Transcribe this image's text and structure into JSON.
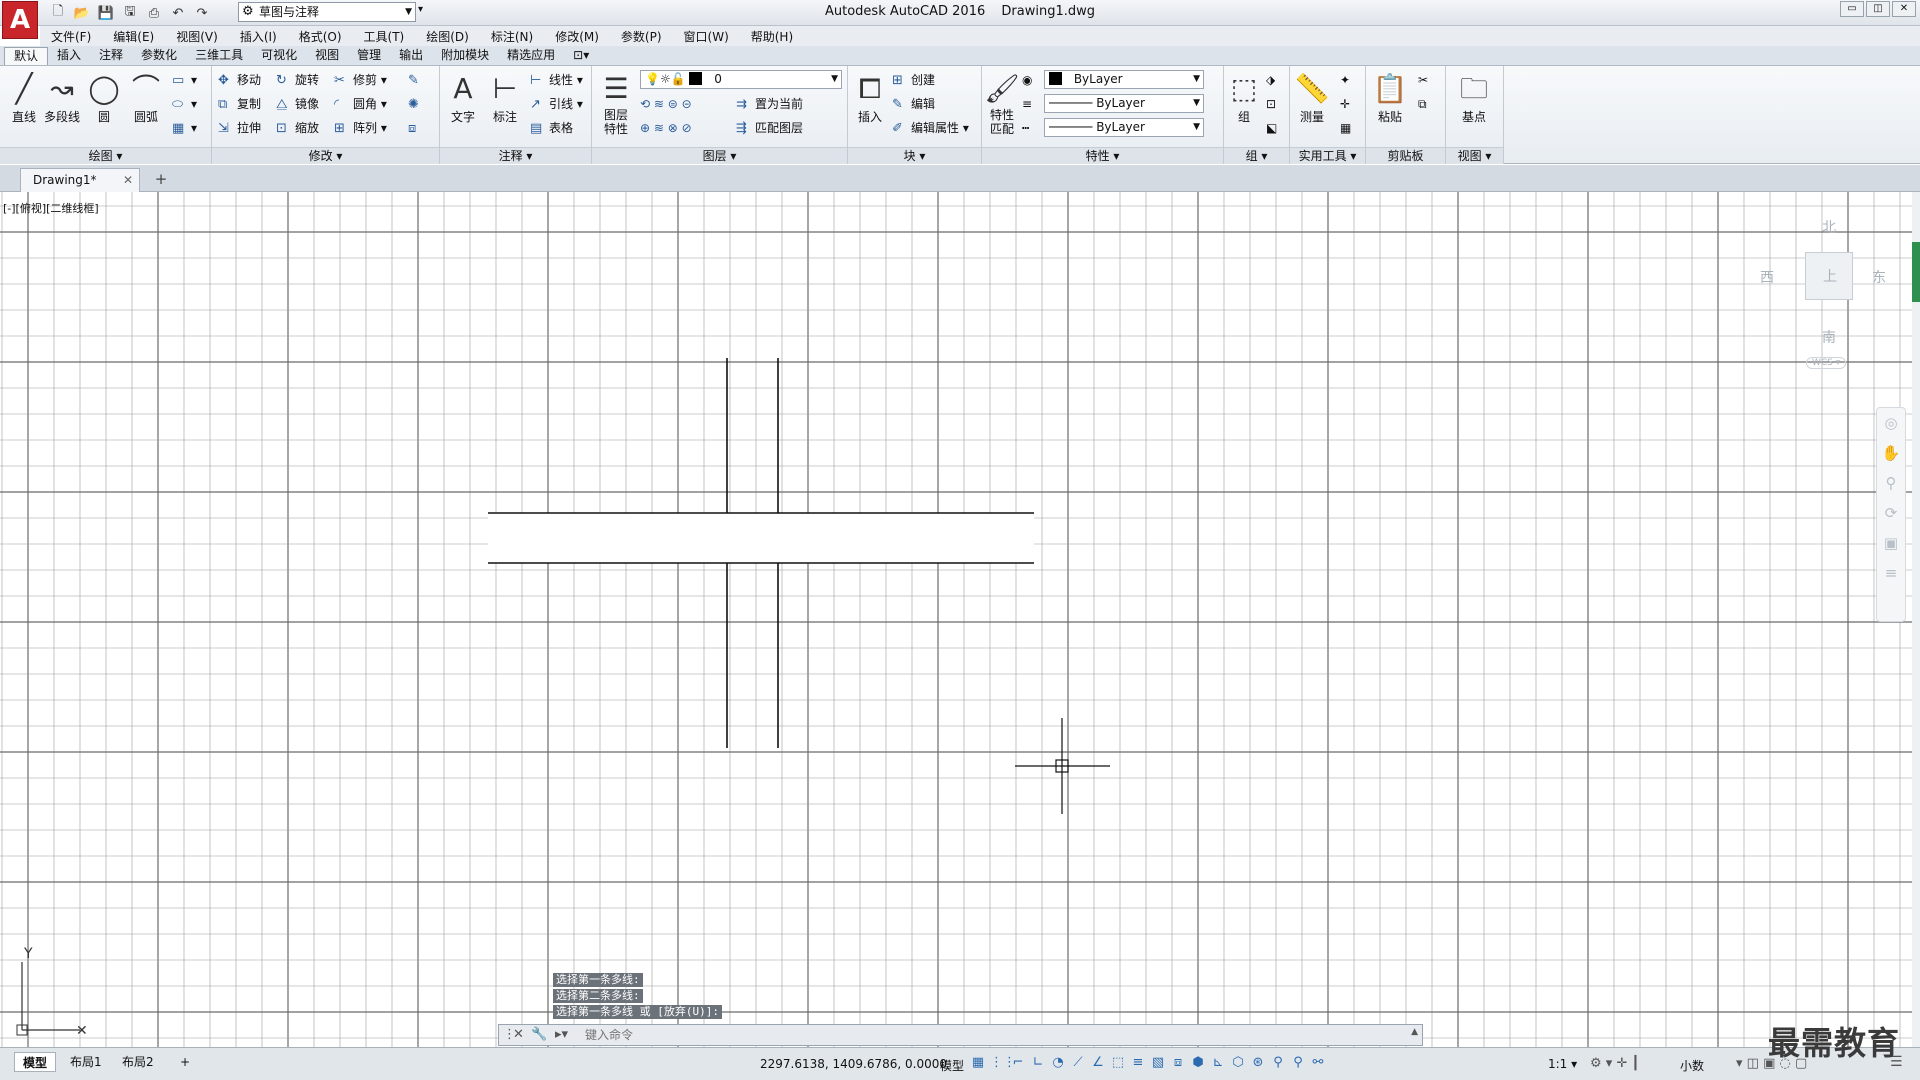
{
  "app": {
    "logo": "A",
    "title": "Autodesk AutoCAD 2016",
    "document": "Drawing1.dwg",
    "workspace": "草图与注释"
  },
  "window_controls": [
    "▭",
    "◫",
    "✕"
  ],
  "menu": [
    "文件(F)",
    "编辑(E)",
    "视图(V)",
    "插入(I)",
    "格式(O)",
    "工具(T)",
    "绘图(D)",
    "标注(N)",
    "修改(M)",
    "参数(P)",
    "窗口(W)",
    "帮助(H)"
  ],
  "ribbon_tabs": [
    "默认",
    "插入",
    "注释",
    "参数化",
    "三维工具",
    "可视化",
    "视图",
    "管理",
    "输出",
    "附加模块",
    "精选应用"
  ],
  "ribbon": {
    "draw": {
      "title": "绘图 ▾",
      "line": "直线",
      "polyline": "多段线",
      "circle": "圆",
      "arc": "圆弧"
    },
    "modify": {
      "title": "修改 ▾",
      "move": "移动",
      "rotate": "旋转",
      "trim": "修剪",
      "copy": "复制",
      "mirror": "镜像",
      "fillet": "圆角",
      "stretch": "拉伸",
      "scale": "缩放",
      "array": "阵列"
    },
    "annotation": {
      "title": "注释 ▾",
      "text": "文字",
      "dimension": "标注",
      "linear": "线性",
      "leader": "引线",
      "table": "表格"
    },
    "layers": {
      "title": "图层 ▾",
      "properties_l1": "图层",
      "properties_l2": "特性",
      "layer_value": "0",
      "set_current": "置为当前",
      "match_layer": "匹配图层"
    },
    "block": {
      "title": "块 ▾",
      "insert": "插入",
      "create": "创建",
      "edit": "编辑",
      "edit_attributes": "编辑属性"
    },
    "properties": {
      "title": "特性 ▾",
      "match_l1": "特性",
      "match_l2": "匹配",
      "color": "ByLayer",
      "linetype": "ByLayer",
      "lineweight": "ByLayer"
    },
    "groups": {
      "title": "组 ▾",
      "group": "组"
    },
    "utilities": {
      "title": "实用工具 ▾",
      "measure": "测量"
    },
    "clipboard": {
      "title": "剪贴板",
      "paste": "粘贴"
    },
    "view": {
      "title": "视图 ▾",
      "basepoint": "基点"
    }
  },
  "doc_tab": {
    "label": "Drawing1*",
    "close": "✕",
    "new": "+"
  },
  "viewport": {
    "label": "[-][俯视][二维线框]",
    "viewcube": {
      "north": "北",
      "south": "南",
      "west": "西",
      "east": "东",
      "face": "上",
      "wcs": "WCS ▾"
    }
  },
  "command": {
    "history": [
      "选择第一条多线:",
      "选择第二条多线:",
      "选择第一条多线 或 [放弃(U)]:"
    ],
    "placeholder": "键入命令"
  },
  "status": {
    "layout_tabs": [
      "模型",
      "布局1",
      "布局2"
    ],
    "coords": "2297.6138, 1409.6786, 0.0000",
    "mode": "模型",
    "scale": "1:1 ▾",
    "units": "小数"
  },
  "watermark": "最需教育",
  "colors": {
    "accent": "#c8262b",
    "scroll_thumb": "#2f8f4f"
  }
}
